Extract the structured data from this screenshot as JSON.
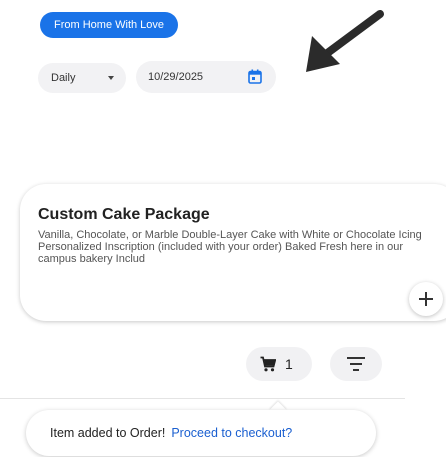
{
  "header": {
    "chip_label": "From Home With Love"
  },
  "filters": {
    "frequency_value": "Daily",
    "date_value": "10/29/2025"
  },
  "product": {
    "title": "Custom Cake Package",
    "description": "Vanilla, Chocolate, or Marble Double-Layer Cake with White or Chocolate Icing Personalized Inscription (included with your order) Baked Fresh here in our campus bakery Includ"
  },
  "cart": {
    "count": "1"
  },
  "toast": {
    "message": "Item added to Order!",
    "link_label": "Proceed to checkout?"
  },
  "icons": {
    "arrow": "arrow-down-left-icon",
    "calendar": "calendar-icon",
    "plus": "plus-icon",
    "cart": "cart-icon",
    "filter": "filter-lines-icon"
  },
  "colors": {
    "accent": "#1a73e8",
    "link": "#1a5fd0",
    "pill_bg": "#f2f2f4"
  }
}
